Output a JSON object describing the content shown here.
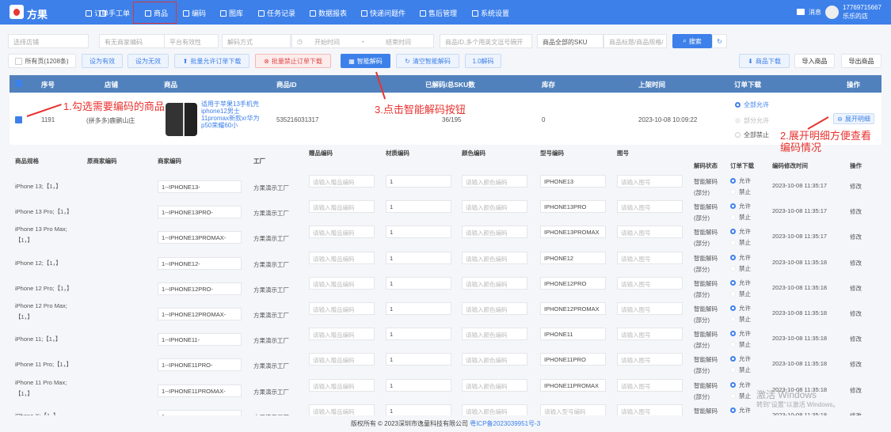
{
  "nav": {
    "brand": "方果",
    "items": [
      "订单",
      "手工单",
      "商品",
      "编码",
      "图库",
      "任务记录",
      "数据报表",
      "快递问题件",
      "售后管理",
      "系统设置"
    ],
    "active": "商品",
    "message": "消息",
    "user_phone": "17769715667",
    "user_shop": "乐乐的店"
  },
  "filters": {
    "shop": "选择店铺",
    "merchant_code": "有无商家编码",
    "platform_valid": "平台有效性",
    "decode_mode": "解码方式",
    "start": "开始时间",
    "sep": "-",
    "end": "结束时间",
    "product_id": "商品ID,多个用英文逗号隔开",
    "sku_scope": "商品全部的SKU",
    "title_placeholder": "商品标题/商品规格/",
    "search": "搜索"
  },
  "toolbar": {
    "all_pages": "所有页(1208条)",
    "set_valid": "设为有效",
    "set_invalid": "设为无效",
    "batch_allow": "批量允许订单下载",
    "batch_forbid": "批量禁止订单下载",
    "smart_decode": "智能解码",
    "clear_smart": "清空智能解码",
    "decode_10": "1.0解码",
    "download": "商品下载",
    "import": "导入商品",
    "export": "导出商品"
  },
  "table": {
    "headers": [
      "序号",
      "店铺",
      "商品",
      "商品ID",
      "已解码/总SKU数",
      "库存",
      "上架时间",
      "订单下载",
      "操作"
    ],
    "row": {
      "index": "1191",
      "shop": "(拼多多)鹿鹂山庄",
      "title": "适用于苹果13手机壳iphone12男士11promax新款xr华为p50荣耀60小",
      "id": "535216031317",
      "decoded": "36/195",
      "stock": "0",
      "time": "2023-10-08 10:09:22",
      "dl_options": [
        "全部允许",
        "部分允许",
        "全部禁止"
      ],
      "expand": "展开明细"
    }
  },
  "annotations": {
    "step1": "1.勾选需要编码的商品",
    "step2": "2.展开明细方便查看编码情况",
    "step3": "3.点击智能解码按钮"
  },
  "sub": {
    "headers": [
      "商品规格",
      "原商家编码",
      "商家编码",
      "工厂",
      "赠品编码",
      "材质编码",
      "颜色编码",
      "型号编码",
      "图号",
      "解码状态",
      "订单下载",
      "编码修改时间",
      "操作"
    ],
    "placeholders": {
      "gift": "请输入赠品编码",
      "color": "请输入颜色编码",
      "model": "请输入型号编码",
      "figure": "请输入图号"
    },
    "factory": "方果演示工厂",
    "status": [
      "智能解码",
      "(部分)"
    ],
    "allow": "允许",
    "forbid": "禁止",
    "edit": "修改",
    "rows": [
      {
        "spec": "iPhone 13;【1，】",
        "code": "1--IPHONE13-",
        "material": "1",
        "model": "IPHONE13",
        "time": "2023-10-08 11:35:17"
      },
      {
        "spec": "iPhone 13 Pro;【1，】",
        "code": "1--IPHONE13PRO-",
        "material": "1",
        "model": "IPHONE13PRO",
        "time": "2023-10-08 11:35:17"
      },
      {
        "spec": "iPhone 13 Pro Max;【1，】",
        "code": "1--IPHONE13PROMAX-",
        "material": "1",
        "model": "IPHONE13PROMAX",
        "time": "2023-10-08 11:35:17"
      },
      {
        "spec": "iPhone 12;【1，】",
        "code": "1--IPHONE12-",
        "material": "1",
        "model": "IPHONE12",
        "time": "2023-10-08 11:35:18"
      },
      {
        "spec": "iPhone 12 Pro;【1，】",
        "code": "1--IPHONE12PRO-",
        "material": "1",
        "model": "IPHONE12PRO",
        "time": "2023-10-08 11:35:18"
      },
      {
        "spec": "iPhone 12 Pro Max;【1，】",
        "code": "1--IPHONE12PROMAX-",
        "material": "1",
        "model": "IPHONE12PROMAX",
        "time": "2023-10-08 11:35:18"
      },
      {
        "spec": "iPhone 11;【1，】",
        "code": "1--IPHONE11-",
        "material": "1",
        "model": "IPHONE11",
        "time": "2023-10-08 11:35:18"
      },
      {
        "spec": "iPhone 11 Pro;【1，】",
        "code": "1--IPHONE11PRO-",
        "material": "1",
        "model": "IPHONE11PRO",
        "time": "2023-10-08 11:35:18"
      },
      {
        "spec": "iPhone 11 Pro Max;【1，】",
        "code": "1--IPHONE11PROMAX-",
        "material": "1",
        "model": "IPHONE11PROMAX",
        "time": "2023-10-08 11:35:18"
      },
      {
        "spec": "iPhone X;【1，】",
        "code": "1",
        "material": "1",
        "model": "",
        "time": "2023-10-08 11:35:18"
      }
    ]
  },
  "footer": {
    "copyright": "版权所有 © 2023深圳市逸童科技有限公司",
    "icp": "粤ICP备2023039951号-3"
  },
  "watermark": {
    "line1": "激活 Windows",
    "line2": "转到\"设置\"以激活 Windows。"
  }
}
